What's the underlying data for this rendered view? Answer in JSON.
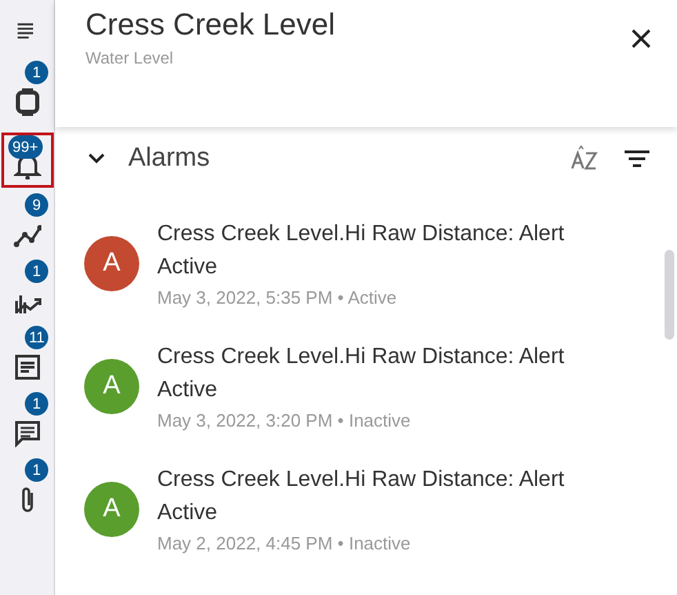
{
  "sidebar": {
    "items": [
      {
        "kind": "menu",
        "selected": false
      },
      {
        "kind": "device",
        "badge": "1",
        "selected": false
      },
      {
        "kind": "bell",
        "badge": "99+",
        "selected": true
      },
      {
        "kind": "trend",
        "badge": "9",
        "selected": false
      },
      {
        "kind": "chart",
        "badge": "1",
        "selected": false
      },
      {
        "kind": "doc",
        "badge": "11",
        "selected": false
      },
      {
        "kind": "comment",
        "badge": "1",
        "selected": false
      },
      {
        "kind": "clip",
        "badge": "1",
        "selected": false
      }
    ]
  },
  "header": {
    "title": "Cress Creek Level",
    "subtitle": "Water Level"
  },
  "section": {
    "title": "Alarms",
    "expanded": true
  },
  "alarms": [
    {
      "avatar": "A",
      "color": "#c34a30",
      "title": "Cress Creek Level.Hi Raw Distance: Alert Active",
      "meta": "May 3, 2022, 5:35 PM • Active"
    },
    {
      "avatar": "A",
      "color": "#5a9e2e",
      "title": "Cress Creek Level.Hi Raw Distance: Alert Active",
      "meta": "May 3, 2022, 3:20 PM • Inactive"
    },
    {
      "avatar": "A",
      "color": "#5a9e2e",
      "title": "Cress Creek Level.Hi Raw Distance: Alert Active",
      "meta": "May 2, 2022, 4:45 PM • Inactive"
    }
  ]
}
